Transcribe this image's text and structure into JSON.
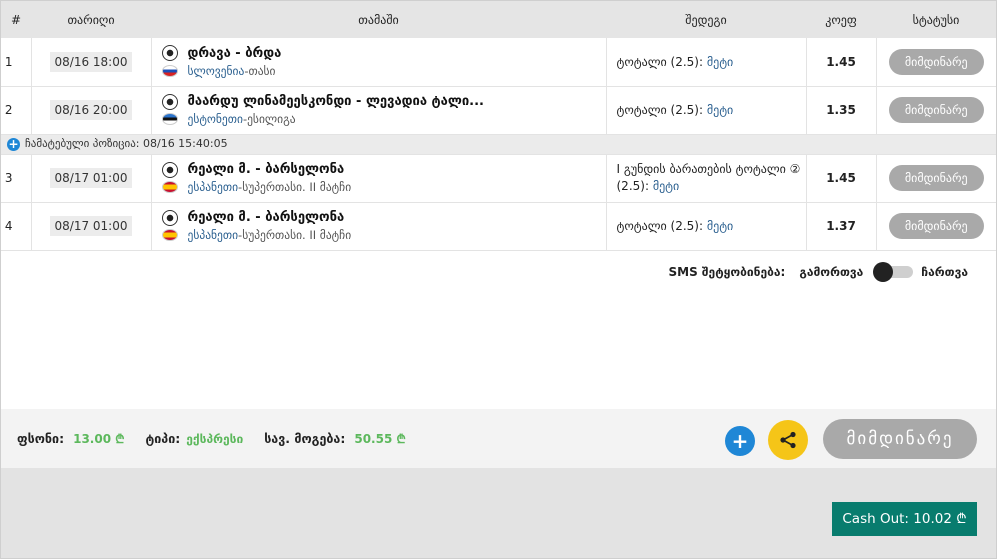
{
  "header": {
    "num": "#",
    "date": "თარიღი",
    "game": "თამაში",
    "market": "შედეგი",
    "odds": "კოეფ",
    "status": "სტატუსი"
  },
  "rows": [
    {
      "num": "1",
      "date": "08/16 18:00",
      "match": "დრავა - ბრდა",
      "country": "სლოვენია",
      "separator": " - ",
      "league": "თასი",
      "flag": "slovenia-flag-icon",
      "market": "ტოტალი (2.5): ",
      "outcome": "მეტი",
      "odds": "1.45",
      "status": "მიმდინარე"
    },
    {
      "num": "2",
      "date": "08/16 20:00",
      "match": "მაარდუ ლინამეესკონდი - ლევადია ტალი...",
      "country": "ესტონეთი",
      "separator": " - ",
      "league": "ესილიგა",
      "flag": "estonia-flag-icon",
      "market": "ტოტალი (2.5): ",
      "outcome": "მეტი",
      "odds": "1.35",
      "status": "მიმდინარე"
    },
    {
      "num": "3",
      "date": "08/17 01:00",
      "match": "რეალი მ. - ბარსელონა",
      "country": "ესპანეთი",
      "separator": " - ",
      "league": "სუპერთასი. II მატჩი",
      "flag": "spain-flag-icon",
      "market": "I გუნდის ბარათების ტოტალი ② (2.5): ",
      "outcome": "მეტი",
      "odds": "1.45",
      "status": "მიმდინარე"
    },
    {
      "num": "4",
      "date": "08/17 01:00",
      "match": "რეალი მ. - ბარსელონა",
      "country": "ესპანეთი",
      "separator": " - ",
      "league": "სუპერთასი. II მატჩი",
      "flag": "spain-flag-icon",
      "market": "ტოტალი (2.5): ",
      "outcome": "მეტი",
      "odds": "1.37",
      "status": "მიმდინარე"
    }
  ],
  "time_row": {
    "icon": "plus-icon",
    "text": "ჩამატებული პოზიცია: 08/16 15:40:05"
  },
  "sms": {
    "label": "SMS შეტყობინება:",
    "off": "გამორთვა",
    "on": "ჩართვა",
    "enabled": false
  },
  "footer": {
    "stake_label": "ფსონი:",
    "stake_value": "13.00 ₾",
    "type_label": "ტიპი:",
    "type_value": "ექსპრესი",
    "win_label": "სავ. მოგება:",
    "win_value": "50.55 ₾",
    "plus_icon": "plus-icon",
    "share_icon": "share-icon",
    "status_button": "მიმდინარე"
  },
  "cashout": {
    "label": "Cash Out: 10.02 ₾"
  },
  "colors": {
    "accent_blue": "#1f87d6",
    "share_yellow": "#f5c518",
    "positive_green": "#5cb85c",
    "cashout_teal": "#087c6e",
    "status_gray": "#a9a9a9",
    "link_blue": "#2a5f8f"
  }
}
